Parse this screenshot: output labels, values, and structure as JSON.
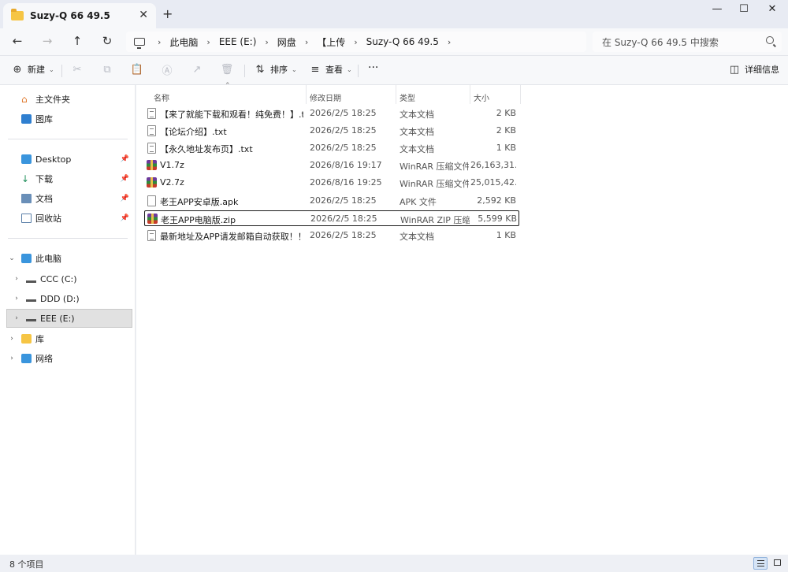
{
  "window": {
    "tab_title": "Suzy-Q 66 49.5",
    "close_tab": "✕",
    "new_tab": "+",
    "minimize": "—",
    "maximize": "☐",
    "close": "✕"
  },
  "nav": {
    "back": "←",
    "forward": "→",
    "up": "↑",
    "refresh": "↻",
    "breadcrumbs": [
      "此电脑",
      "EEE (E:)",
      "网盘",
      "【上传",
      "Suzy-Q 66 49.5"
    ],
    "search_placeholder": "在 Suzy-Q 66 49.5 中搜索"
  },
  "toolbar": {
    "new_label": "新建",
    "sort_label": "排序",
    "view_label": "查看",
    "more": "···",
    "details_label": "详细信息"
  },
  "sidebar": {
    "quick": [
      {
        "label": "主文件夹",
        "icon": "home-icon"
      },
      {
        "label": "图库",
        "icon": "gallery-icon"
      }
    ],
    "pinned": [
      {
        "label": "Desktop",
        "icon": "desktop-icon"
      },
      {
        "label": "下载",
        "icon": "download-icon"
      },
      {
        "label": "文档",
        "icon": "documents-icon"
      },
      {
        "label": "回收站",
        "icon": "recycle-bin-icon"
      }
    ],
    "this_pc": "此电脑",
    "drives": [
      {
        "label": "CCC (C:)",
        "icon": "system-drive-icon"
      },
      {
        "label": "DDD (D:)",
        "icon": "drive-icon"
      },
      {
        "label": "EEE (E:)",
        "icon": "drive-icon",
        "selected": true
      }
    ],
    "libraries": "库",
    "network": "网络"
  },
  "columns": {
    "name": "名称",
    "date": "修改日期",
    "type": "类型",
    "size": "大小"
  },
  "files": [
    {
      "name": "【来了就能下载和观看！纯免费！】.txt",
      "date": "2026/2/5 18:25",
      "type": "文本文档",
      "size": "2 KB",
      "icon": "text-file-icon"
    },
    {
      "name": "【论坛介绍】.txt",
      "date": "2026/2/5 18:25",
      "type": "文本文档",
      "size": "2 KB",
      "icon": "text-file-icon"
    },
    {
      "name": "【永久地址发布页】.txt",
      "date": "2026/2/5 18:25",
      "type": "文本文档",
      "size": "1 KB",
      "icon": "text-file-icon"
    },
    {
      "name": "V1.7z",
      "date": "2026/8/16 19:17",
      "type": "WinRAR 压缩文件",
      "size": "26,163,31...",
      "icon": "winrar-icon"
    },
    {
      "name": "V2.7z",
      "date": "2026/8/16 19:25",
      "type": "WinRAR 压缩文件",
      "size": "25,015,42...",
      "icon": "winrar-icon"
    },
    {
      "name": "老王APP安卓版.apk",
      "date": "2026/2/5 18:25",
      "type": "APK 文件",
      "size": "2,592 KB",
      "icon": "blank-file-icon"
    },
    {
      "name": "老王APP电脑版.zip",
      "date": "2026/2/5 18:25",
      "type": "WinRAR ZIP 压缩...",
      "size": "5,599 KB",
      "icon": "winrar-icon",
      "focused": true
    },
    {
      "name": "最新地址及APP请发邮箱自动获取！！！....",
      "date": "2026/2/5 18:25",
      "type": "文本文档",
      "size": "1 KB",
      "icon": "text-file-icon"
    }
  ],
  "status": {
    "item_count": "8 个项目"
  }
}
